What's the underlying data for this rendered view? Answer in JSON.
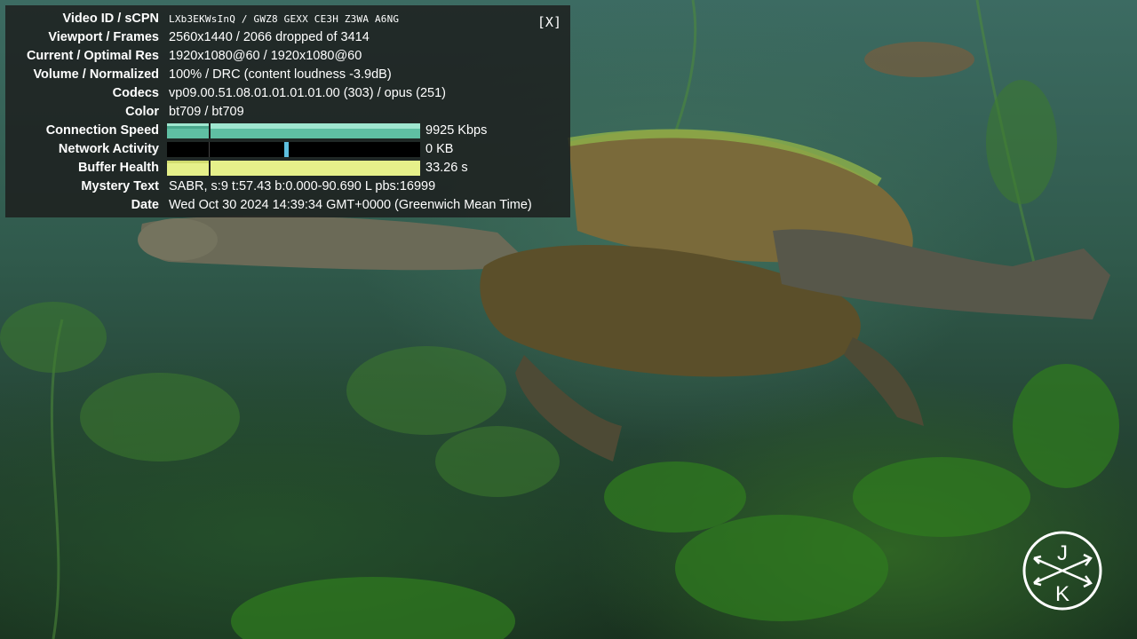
{
  "overlay": {
    "close_label": "[X]",
    "rows": {
      "video_id": {
        "label": "Video ID / sCPN",
        "value": "LXb3EKWsInQ / GWZ8 GEXX CE3H Z3WA A6NG"
      },
      "viewport": {
        "label": "Viewport / Frames",
        "value": "2560x1440 / 2066 dropped of 3414"
      },
      "resolution": {
        "label": "Current / Optimal Res",
        "value": "1920x1080@60 / 1920x1080@60"
      },
      "volume": {
        "label": "Volume / Normalized",
        "value": "100% / DRC (content loudness -3.9dB)"
      },
      "codecs": {
        "label": "Codecs",
        "value": "vp09.00.51.08.01.01.01.01.00 (303) / opus (251)"
      },
      "color": {
        "label": "Color",
        "value": "bt709 / bt709"
      },
      "connection": {
        "label": "Connection Speed",
        "value": "9925 Kbps"
      },
      "network": {
        "label": "Network Activity",
        "value": "0 KB"
      },
      "buffer": {
        "label": "Buffer Health",
        "value": "33.26 s"
      },
      "mystery": {
        "label": "Mystery Text",
        "value": "SABR, s:9 t:57.43 b:0.000-90.690 L pbs:16999"
      },
      "date": {
        "label": "Date",
        "value": "Wed Oct 30 2024 14:39:34 GMT+0000 (Greenwich Mean Time)"
      }
    }
  },
  "colors": {
    "connection_bar": "#6fd0b5",
    "network_bar": "#5ec0e0",
    "buffer_bar": "#e6f08a",
    "overlay_bg": "rgba(28,28,28,0.82)"
  },
  "video": {
    "subject": "turtle-swimming-underwater"
  },
  "logo": {
    "letter_top": "J",
    "letter_bottom": "K",
    "icon": "crossed-arrows-icon"
  }
}
